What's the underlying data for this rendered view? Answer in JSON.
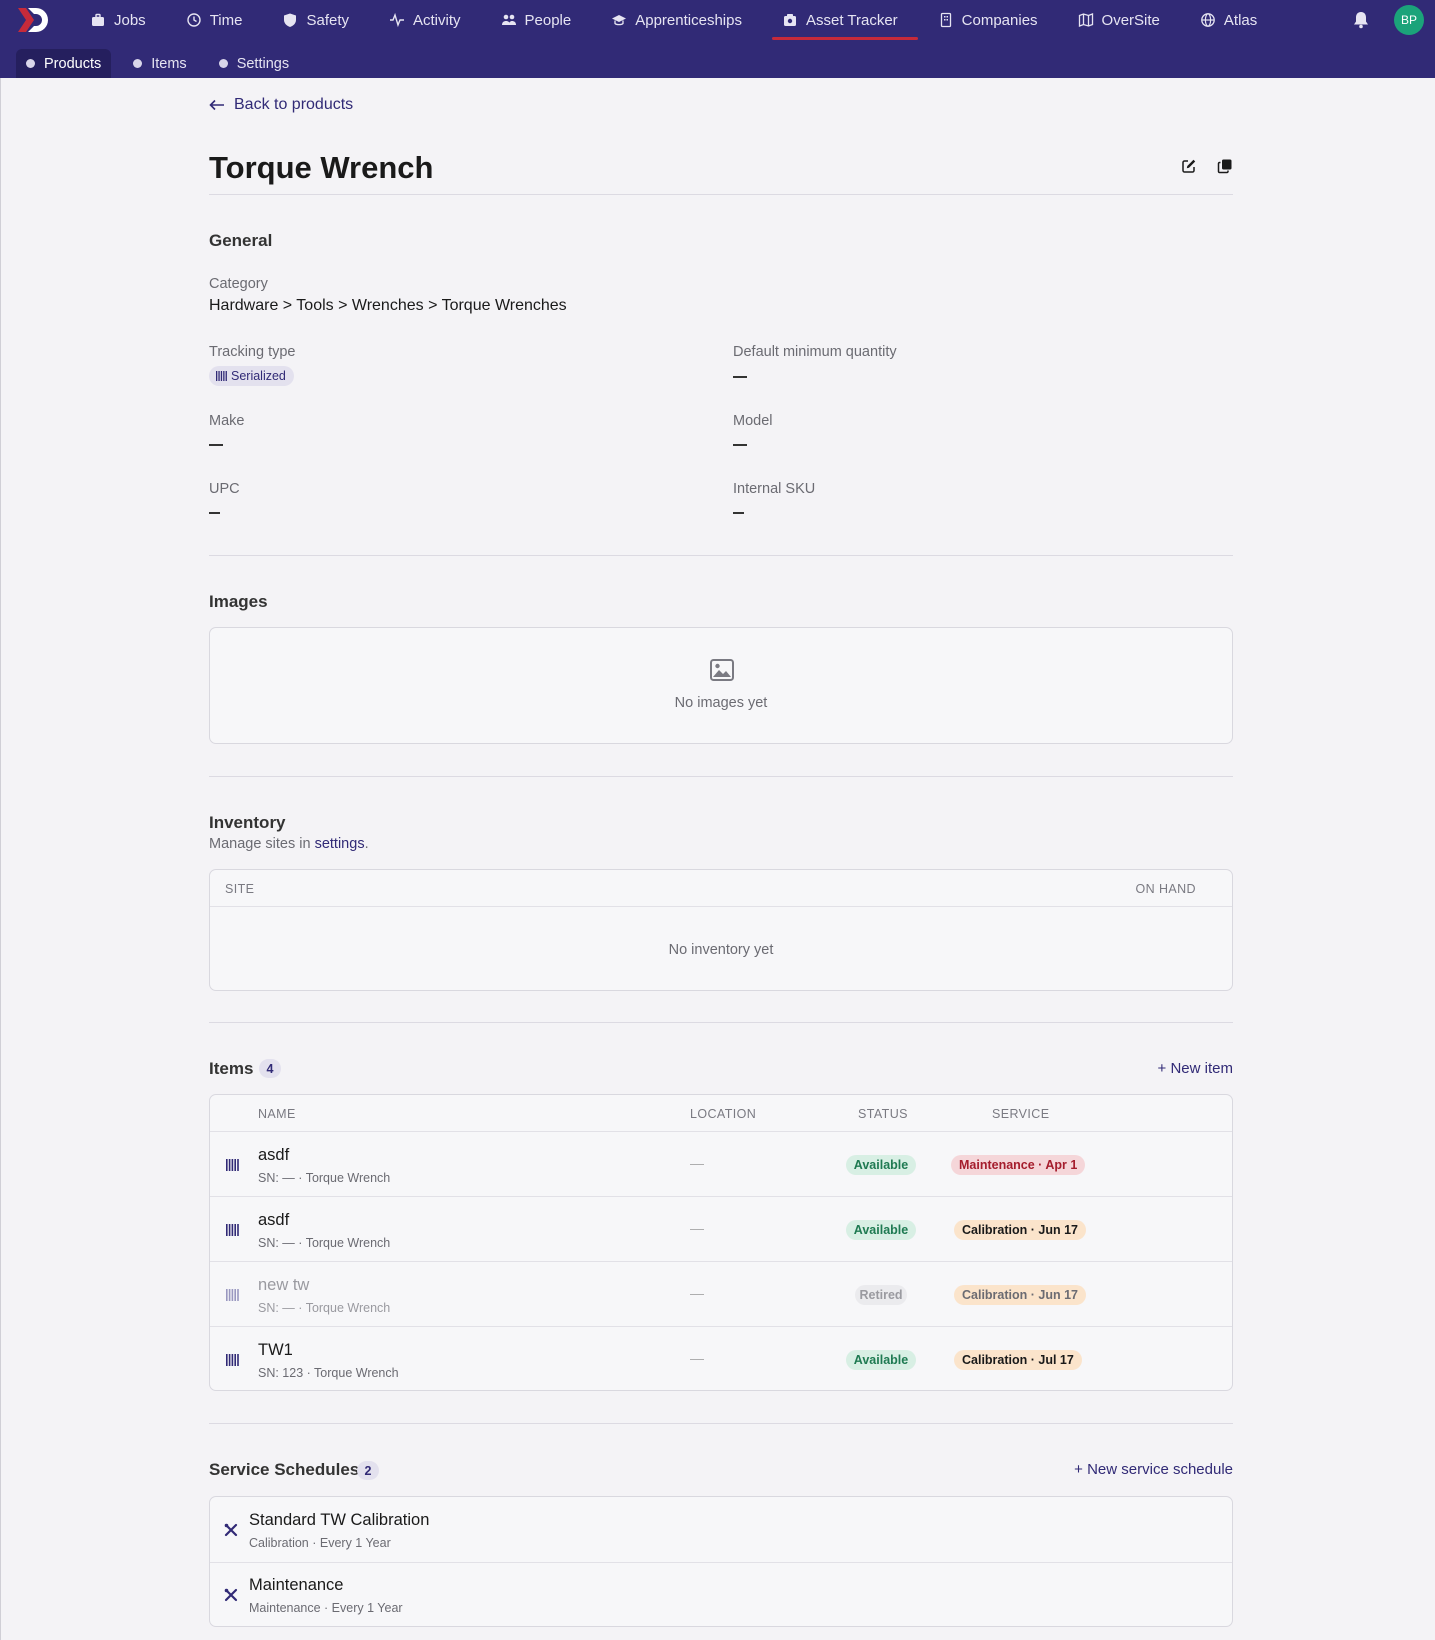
{
  "nav": {
    "items": [
      {
        "label": "Jobs",
        "icon": "briefcase-icon"
      },
      {
        "label": "Time",
        "icon": "clock-icon"
      },
      {
        "label": "Safety",
        "icon": "shield-icon"
      },
      {
        "label": "Activity",
        "icon": "activity-icon"
      },
      {
        "label": "People",
        "icon": "people-icon"
      },
      {
        "label": "Apprenticeships",
        "icon": "graduation-cap-icon"
      },
      {
        "label": "Asset Tracker",
        "icon": "asset-tracker-icon",
        "active": true
      },
      {
        "label": "Companies",
        "icon": "building-icon"
      },
      {
        "label": "OverSite",
        "icon": "map-icon"
      },
      {
        "label": "Atlas",
        "icon": "globe-icon"
      }
    ],
    "avatar_initials": "BP"
  },
  "subnav": {
    "items": [
      {
        "label": "Products",
        "active": true
      },
      {
        "label": "Items"
      },
      {
        "label": "Settings"
      }
    ]
  },
  "page": {
    "back_label": "Back to products",
    "title": "Torque Wrench"
  },
  "general": {
    "heading": "General",
    "category_label": "Category",
    "category_value": "Hardware > Tools > Wrenches > Torque Wrenches",
    "tracking_type_label": "Tracking type",
    "tracking_type_value": "Serialized",
    "default_min_qty_label": "Default minimum quantity",
    "make_label": "Make",
    "model_label": "Model",
    "upc_label": "UPC",
    "internal_sku_label": "Internal SKU"
  },
  "images": {
    "heading": "Images",
    "empty_text": "No images yet"
  },
  "inventory": {
    "heading": "Inventory",
    "manage_prefix": "Manage sites in ",
    "manage_link": "settings",
    "manage_suffix": ".",
    "columns": [
      "SITE",
      "ON HAND"
    ],
    "empty_text": "No inventory yet"
  },
  "items": {
    "heading": "Items",
    "count": "4",
    "new_label": "+ New item",
    "columns": [
      "NAME",
      "LOCATION",
      "STATUS",
      "SERVICE"
    ],
    "rows": [
      {
        "name": "asdf",
        "sub": "SN: — · Torque Wrench",
        "location": "—",
        "status": "Available",
        "service": "Maintenance · Apr 1"
      },
      {
        "name": "asdf",
        "sub": "SN: — · Torque Wrench",
        "location": "—",
        "status": "Available",
        "service": "Calibration · Jun 17"
      },
      {
        "name": "new tw",
        "sub": "SN: — · Torque Wrench",
        "location": "—",
        "status": "Retired",
        "service": "Calibration · Jun 17"
      },
      {
        "name": "TW1",
        "sub": "SN: 123 · Torque Wrench",
        "location": "—",
        "status": "Available",
        "service": "Calibration · Jul 17"
      }
    ]
  },
  "schedules": {
    "heading": "Service Schedules",
    "count": "2",
    "new_label": "+ New service schedule",
    "rows": [
      {
        "name": "Standard TW Calibration",
        "sub": "Calibration · Every 1 Year"
      },
      {
        "name": "Maintenance",
        "sub": "Maintenance · Every 1 Year"
      }
    ]
  },
  "colors": {
    "nav_bg": "#312a76",
    "accent_red": "#c62a3a",
    "avatar_bg": "#1ba37a",
    "link": "#312a76"
  }
}
